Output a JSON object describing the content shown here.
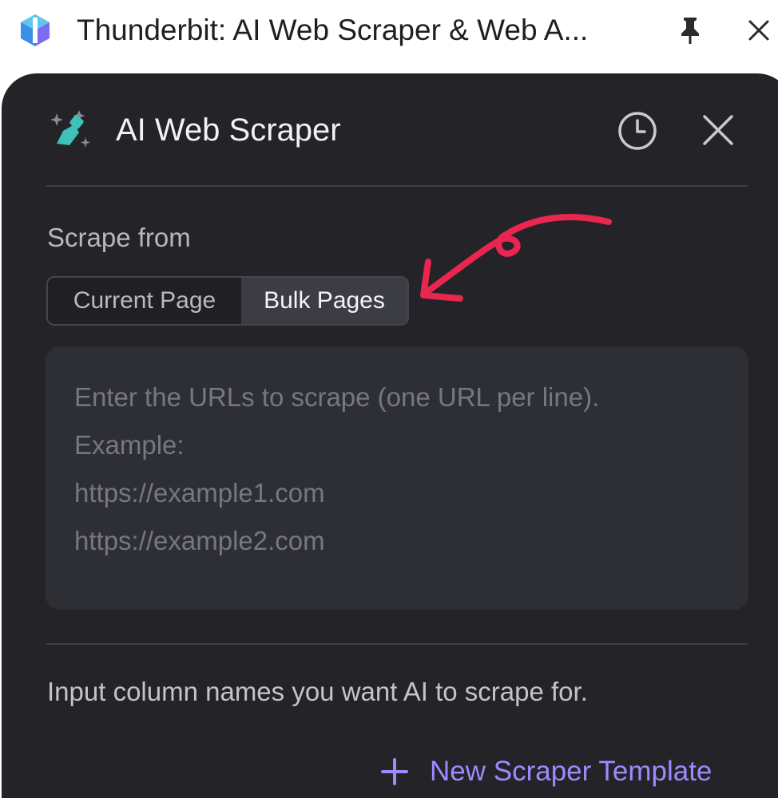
{
  "window": {
    "title": "Thunderbit: AI Web Scraper & Web A...",
    "logo_icon": "thunderbit-logo-icon",
    "pin_icon": "pin-icon",
    "close_icon": "close-icon"
  },
  "panel": {
    "title": "AI Web Scraper",
    "logo_icon": "sparkle-brush-icon",
    "history_icon": "clock-icon",
    "close_icon": "close-icon"
  },
  "scrape_from": {
    "label": "Scrape from",
    "options": [
      {
        "label": "Current Page",
        "selected": false
      },
      {
        "label": "Bulk Pages",
        "selected": true
      }
    ]
  },
  "url_input": {
    "placeholder_lines": [
      "Enter the URLs to scrape (one URL per line).",
      "Example:",
      "https://example1.com",
      "https://example2.com"
    ],
    "value": ""
  },
  "columns": {
    "hint": "Input column names you want AI to scrape for."
  },
  "new_template": {
    "label": "New Scraper Template",
    "icon": "plus-icon"
  },
  "annotation": {
    "type": "hand-drawn-arrow",
    "color": "#e8264f",
    "points_to": "Bulk Pages"
  },
  "colors": {
    "panel_bg": "#232328",
    "input_bg": "#2e2f35",
    "accent": "#9c8bff",
    "logo_teal": "#3ec1b8"
  }
}
